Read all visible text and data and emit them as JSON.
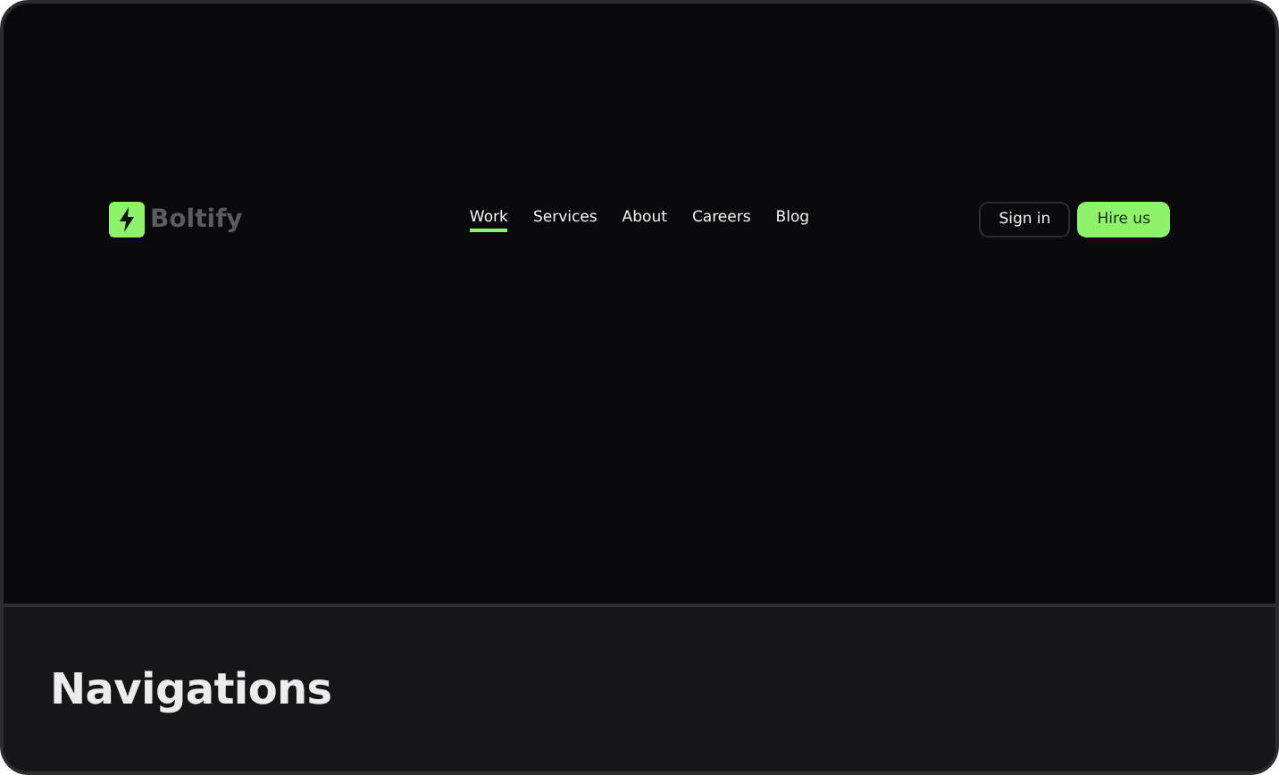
{
  "header": {
    "logo": "Boltify",
    "nav": [
      {
        "label": "Work",
        "selected": true
      },
      {
        "label": "Services",
        "selected": false
      },
      {
        "label": "About",
        "selected": false
      },
      {
        "label": "Careers",
        "selected": false
      },
      {
        "label": "Blog",
        "selected": false
      }
    ],
    "buttons": [
      {
        "label": "Sign in",
        "kind": "outline"
      },
      {
        "label": "Hire us",
        "kind": "primary"
      }
    ]
  },
  "caption": "Navigations"
}
